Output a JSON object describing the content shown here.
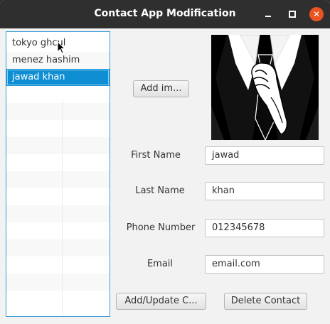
{
  "window": {
    "title": "Contact App Modification"
  },
  "contacts": {
    "items": [
      {
        "label": "tokyo ghcul"
      },
      {
        "label": "menez hashim"
      },
      {
        "label": "jawad khan"
      }
    ],
    "selected_index": 2
  },
  "image": {
    "add_button_label": "Add im...",
    "icon": "suit-tie-hand-image"
  },
  "form": {
    "first_name": {
      "label": "First Name",
      "value": "jawad"
    },
    "last_name": {
      "label": "Last Name",
      "value": "khan"
    },
    "phone": {
      "label": "Phone Number",
      "value": "012345678"
    },
    "email": {
      "label": "Email",
      "value": "email.com"
    }
  },
  "actions": {
    "add_update_label": "Add/Update C...",
    "delete_label": "Delete Contact"
  },
  "colors": {
    "selection": "#0f8ed3",
    "close_button": "#e95420",
    "list_border": "#3a9bd6"
  }
}
